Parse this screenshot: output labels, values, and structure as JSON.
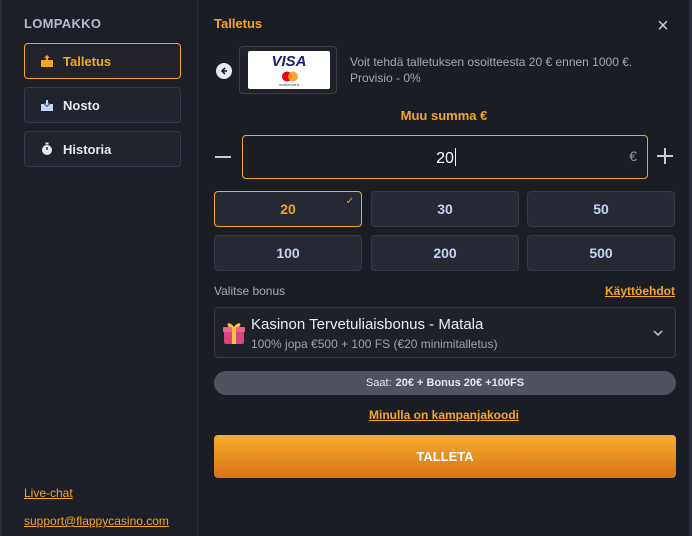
{
  "sidebar": {
    "title": "LOMPAKKO",
    "items": [
      {
        "label": "Talletus",
        "icon": "deposit-icon",
        "active": true
      },
      {
        "label": "Nosto",
        "icon": "withdraw-icon",
        "active": false
      },
      {
        "label": "Historia",
        "icon": "stopwatch-icon",
        "active": false
      }
    ],
    "livechat": "Live-chat",
    "email": "support@flappycasino.com"
  },
  "main": {
    "title": "Talletus",
    "close_icon": "close-icon",
    "method": {
      "name": "VISA",
      "sub": "mastercard"
    },
    "info_line1": "Voit tehdä talletuksen osoitteesta 20 € ennen 1000 €.",
    "info_line2": "Provisio - 0%",
    "amount_label": "Muu summa €",
    "amount_value": "20",
    "currency": "€",
    "chips": [
      "20",
      "30",
      "50",
      "100",
      "200",
      "500"
    ],
    "selected_chip": "20",
    "bonus_label": "Valitse bonus",
    "terms_link": "Käyttöehdot",
    "bonus_title": "Kasinon Tervetuliaisbonus - Matala",
    "bonus_sub": "100% jopa €500 + 100 FS (€20 minimitalletus)",
    "summary_prefix": "Saat:",
    "summary_value": "20€ + Bonus 20€ +100FS",
    "promo_link": "Minulla on kampanjakoodi",
    "submit": "TALLETA"
  },
  "colors": {
    "accent": "#f5a623",
    "panel": "#1b1d25",
    "chip": "#262833",
    "chip_text": "#c7d4f7"
  }
}
